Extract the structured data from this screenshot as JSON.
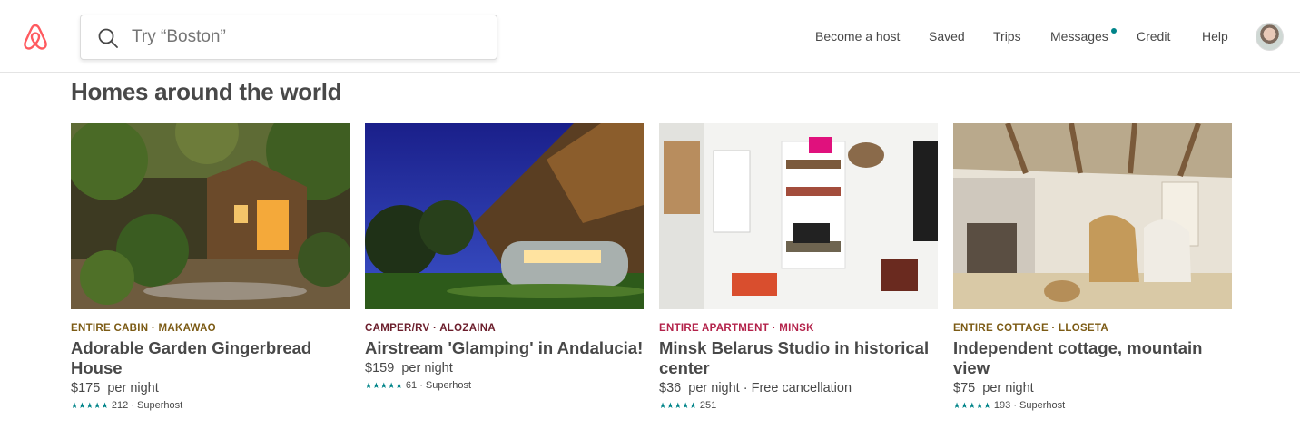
{
  "header": {
    "search_placeholder": "Try “Boston”",
    "nav": {
      "become_host": "Become a host",
      "saved": "Saved",
      "trips": "Trips",
      "messages": "Messages",
      "credit": "Credit",
      "help": "Help"
    }
  },
  "colors": {
    "brand": "#FF5A5F",
    "star": "#008489",
    "cabin_label": "#7C5B15",
    "camper_label": "#6B1D2B",
    "apartment_label": "#B3224A",
    "cottage_label": "#7C5B15"
  },
  "section": {
    "title": "Homes around the world"
  },
  "listings": [
    {
      "type": "ENTIRE CABIN · MAKAWAO",
      "title": "Adorable Garden Gingerbread House",
      "price": "$175",
      "price_suffix": "per night",
      "extra": "",
      "stars": "★★★★★",
      "reviews": "212 · Superhost",
      "rating": 5
    },
    {
      "type": "CAMPER/RV · ALOZAINA",
      "title": "Airstream 'Glamping' in Andalucia!",
      "price": "$159",
      "price_suffix": "per night",
      "extra": "",
      "stars": "★★★★★",
      "reviews": "61 · Superhost",
      "rating": 5
    },
    {
      "type": "ENTIRE APARTMENT · MINSK",
      "title": "Minsk Belarus Studio in historical center",
      "price": "$36",
      "price_suffix": "per night",
      "extra": " · Free cancellation",
      "stars": "★★★★★",
      "reviews": "251",
      "rating": 5
    },
    {
      "type": "ENTIRE COTTAGE · LLOSETA",
      "title": "Independent cottage, mountain view",
      "price": "$75",
      "price_suffix": "per night",
      "extra": "",
      "stars": "★★★★★",
      "reviews": "193 · Superhost",
      "rating": 5
    }
  ]
}
